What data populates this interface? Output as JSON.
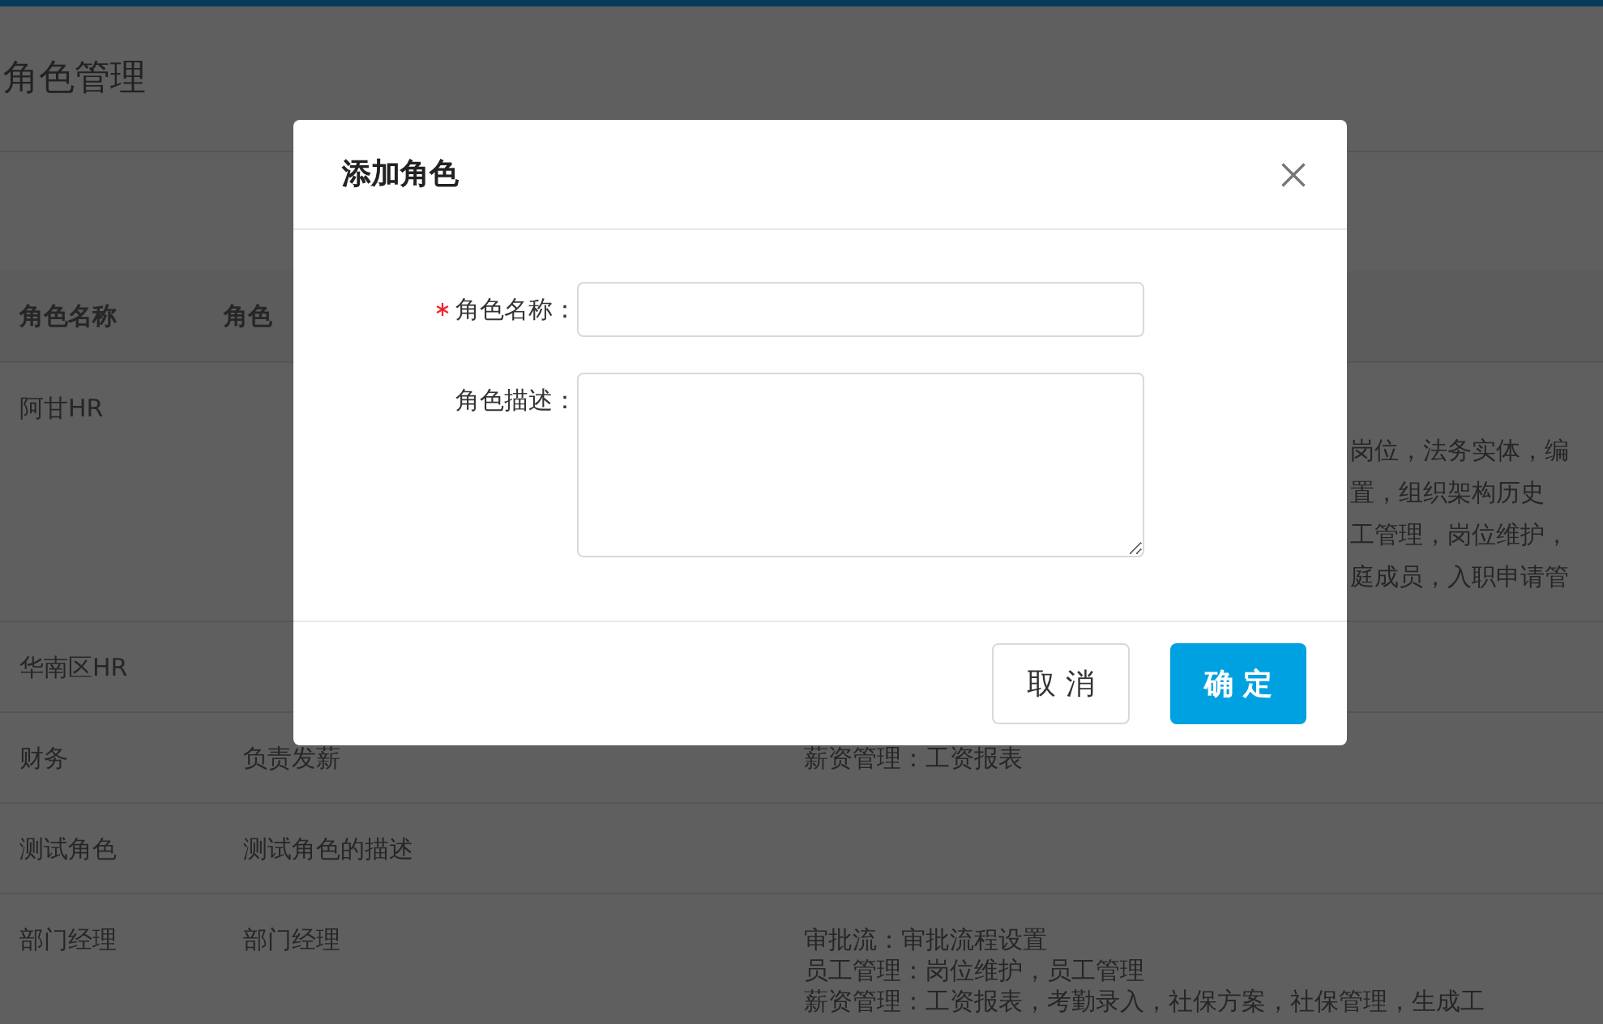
{
  "page": {
    "title": "角色管理"
  },
  "table": {
    "columns": [
      "角色名称",
      "角色"
    ],
    "rows": [
      {
        "name": "阿甘HR",
        "permissions": [
          "岗位，法务实体，编",
          "置，组织架构历史",
          "工管理，岗位维护，",
          "庭成员，入职申请管"
        ]
      },
      {
        "name": "华南区HR"
      },
      {
        "name": "财务",
        "description": "负责发薪",
        "permissions": [
          "薪资管理：工资报表"
        ]
      },
      {
        "name": "测试角色",
        "description": "测试角色的描述"
      },
      {
        "name": "部门经理",
        "description": "部门经理",
        "permissions": [
          "审批流：审批流程设置",
          "员工管理：岗位维护，员工管理",
          "薪资管理：工资报表，考勤录入，社保方案，社保管理，生成工"
        ]
      }
    ]
  },
  "dialog": {
    "title": "添加角色",
    "fields": [
      {
        "label": "角色名称：",
        "required": true,
        "kind": "input"
      },
      {
        "label": "角色描述：",
        "required": false,
        "kind": "textarea"
      }
    ],
    "buttons": [
      {
        "label": "取 消",
        "kind": "default"
      },
      {
        "label": "确 定",
        "kind": "primary"
      }
    ]
  }
}
